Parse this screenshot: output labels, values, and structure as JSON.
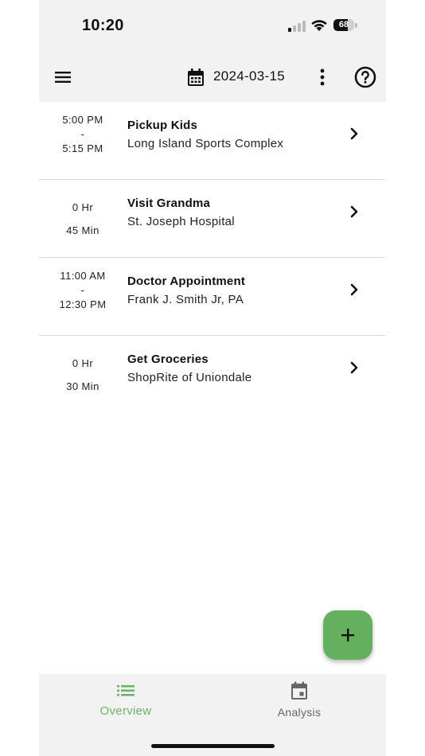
{
  "status_bar": {
    "time": "10:20",
    "battery_percent": "68",
    "battery_level": 0.68
  },
  "app_bar": {
    "date": "2024-03-15",
    "icons": {
      "menu": "hamburger-menu-icon",
      "calendar": "calendar-icon",
      "more": "more-vertical-icon",
      "help": "help-circle-icon"
    }
  },
  "events": [
    {
      "time_top": "5:00 PM",
      "time_mid": "-",
      "time_bottom": "5:15 PM",
      "title": "Pickup Kids",
      "location": "Long Island Sports Complex"
    },
    {
      "time_top": "0 Hr",
      "time_mid": "",
      "time_bottom": "45 Min",
      "title": "Visit Grandma",
      "location": "St. Joseph Hospital"
    },
    {
      "time_top": "11:00 AM",
      "time_mid": "-",
      "time_bottom": "12:30 PM",
      "title": "Doctor Appointment",
      "location": "Frank J. Smith Jr, PA"
    },
    {
      "time_top": "0 Hr",
      "time_mid": "",
      "time_bottom": "30 Min",
      "title": "Get Groceries",
      "location": "ShopRite of Uniondale"
    }
  ],
  "fab": {
    "icon": "plus-icon"
  },
  "bottom_nav": {
    "items": [
      {
        "label": "Overview",
        "icon": "list-icon",
        "active": true
      },
      {
        "label": "Analysis",
        "icon": "calendar-today-icon",
        "active": false
      }
    ]
  },
  "colors": {
    "accent": "#63b05e",
    "active_nav": "#6db368",
    "inactive_nav": "#666666",
    "bar_background": "#f2f2f2",
    "divider": "#dcdcdc"
  }
}
